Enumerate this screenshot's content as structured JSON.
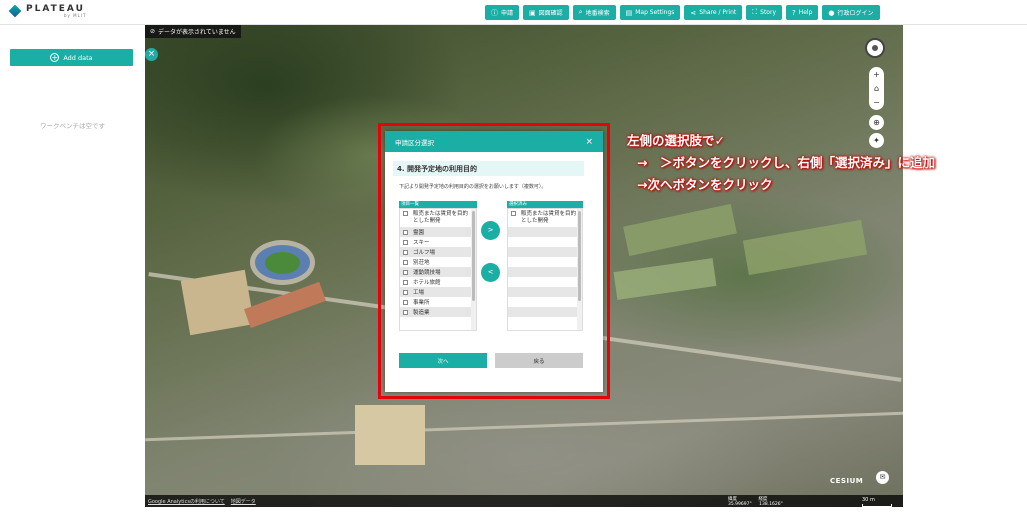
{
  "header": {
    "logo": "PLATEAU",
    "logo_sub": "by MLIT",
    "nav": [
      {
        "label": "申請",
        "icon": "info-icon"
      },
      {
        "label": "図面確認",
        "icon": "map-icon"
      },
      {
        "label": "地番検索",
        "icon": "search-icon"
      },
      {
        "label": "Map Settings",
        "icon": "settings-icon"
      },
      {
        "label": "Share / Print",
        "icon": "share-icon"
      },
      {
        "label": "Story",
        "icon": "story-icon"
      },
      {
        "label": "Help",
        "icon": "help-icon"
      },
      {
        "label": "行政ログイン",
        "icon": "user-icon"
      }
    ]
  },
  "sidebar": {
    "add_data": "Add data",
    "empty": "ワークベンチは空です"
  },
  "map": {
    "toast": "データが表示されていません",
    "footer_links": [
      "Google Analyticsの利用について",
      "地図データ"
    ],
    "coord_lat_label": "緯度",
    "coord_lat": "35.99697°",
    "coord_lon_label": "経度",
    "coord_lon": "138.1626°",
    "cesium": "CESIUM",
    "scale": "30 m"
  },
  "dialog": {
    "title": "申請区分選択",
    "step_title": "4. 開発予定地の利用目的",
    "instruction": "下記より開発予定地の利用目的の選択をお願いします（複数可）。",
    "left_header": "項目一覧",
    "right_header": "選択済み",
    "left_items": [
      "販売または賃貸を目的とした開発",
      "霊園",
      "スキー",
      "ゴルフ場",
      "別荘地",
      "運動競技場",
      "ホテル旅館",
      "工場",
      "事業所",
      "製造業"
    ],
    "right_items": [
      "販売または賃貸を目的とした開発"
    ],
    "add_btn": ">",
    "remove_btn": "<",
    "next": "次へ",
    "back": "戻る"
  },
  "annotation": {
    "line1": "左側の選択肢で✓",
    "line2": "→　＞ボタンをクリックし、右側「選択済み」に追加",
    "line3": "→次へボタンをクリック"
  },
  "colors": {
    "accent": "#1aaea5",
    "highlight": "#e8000b"
  }
}
